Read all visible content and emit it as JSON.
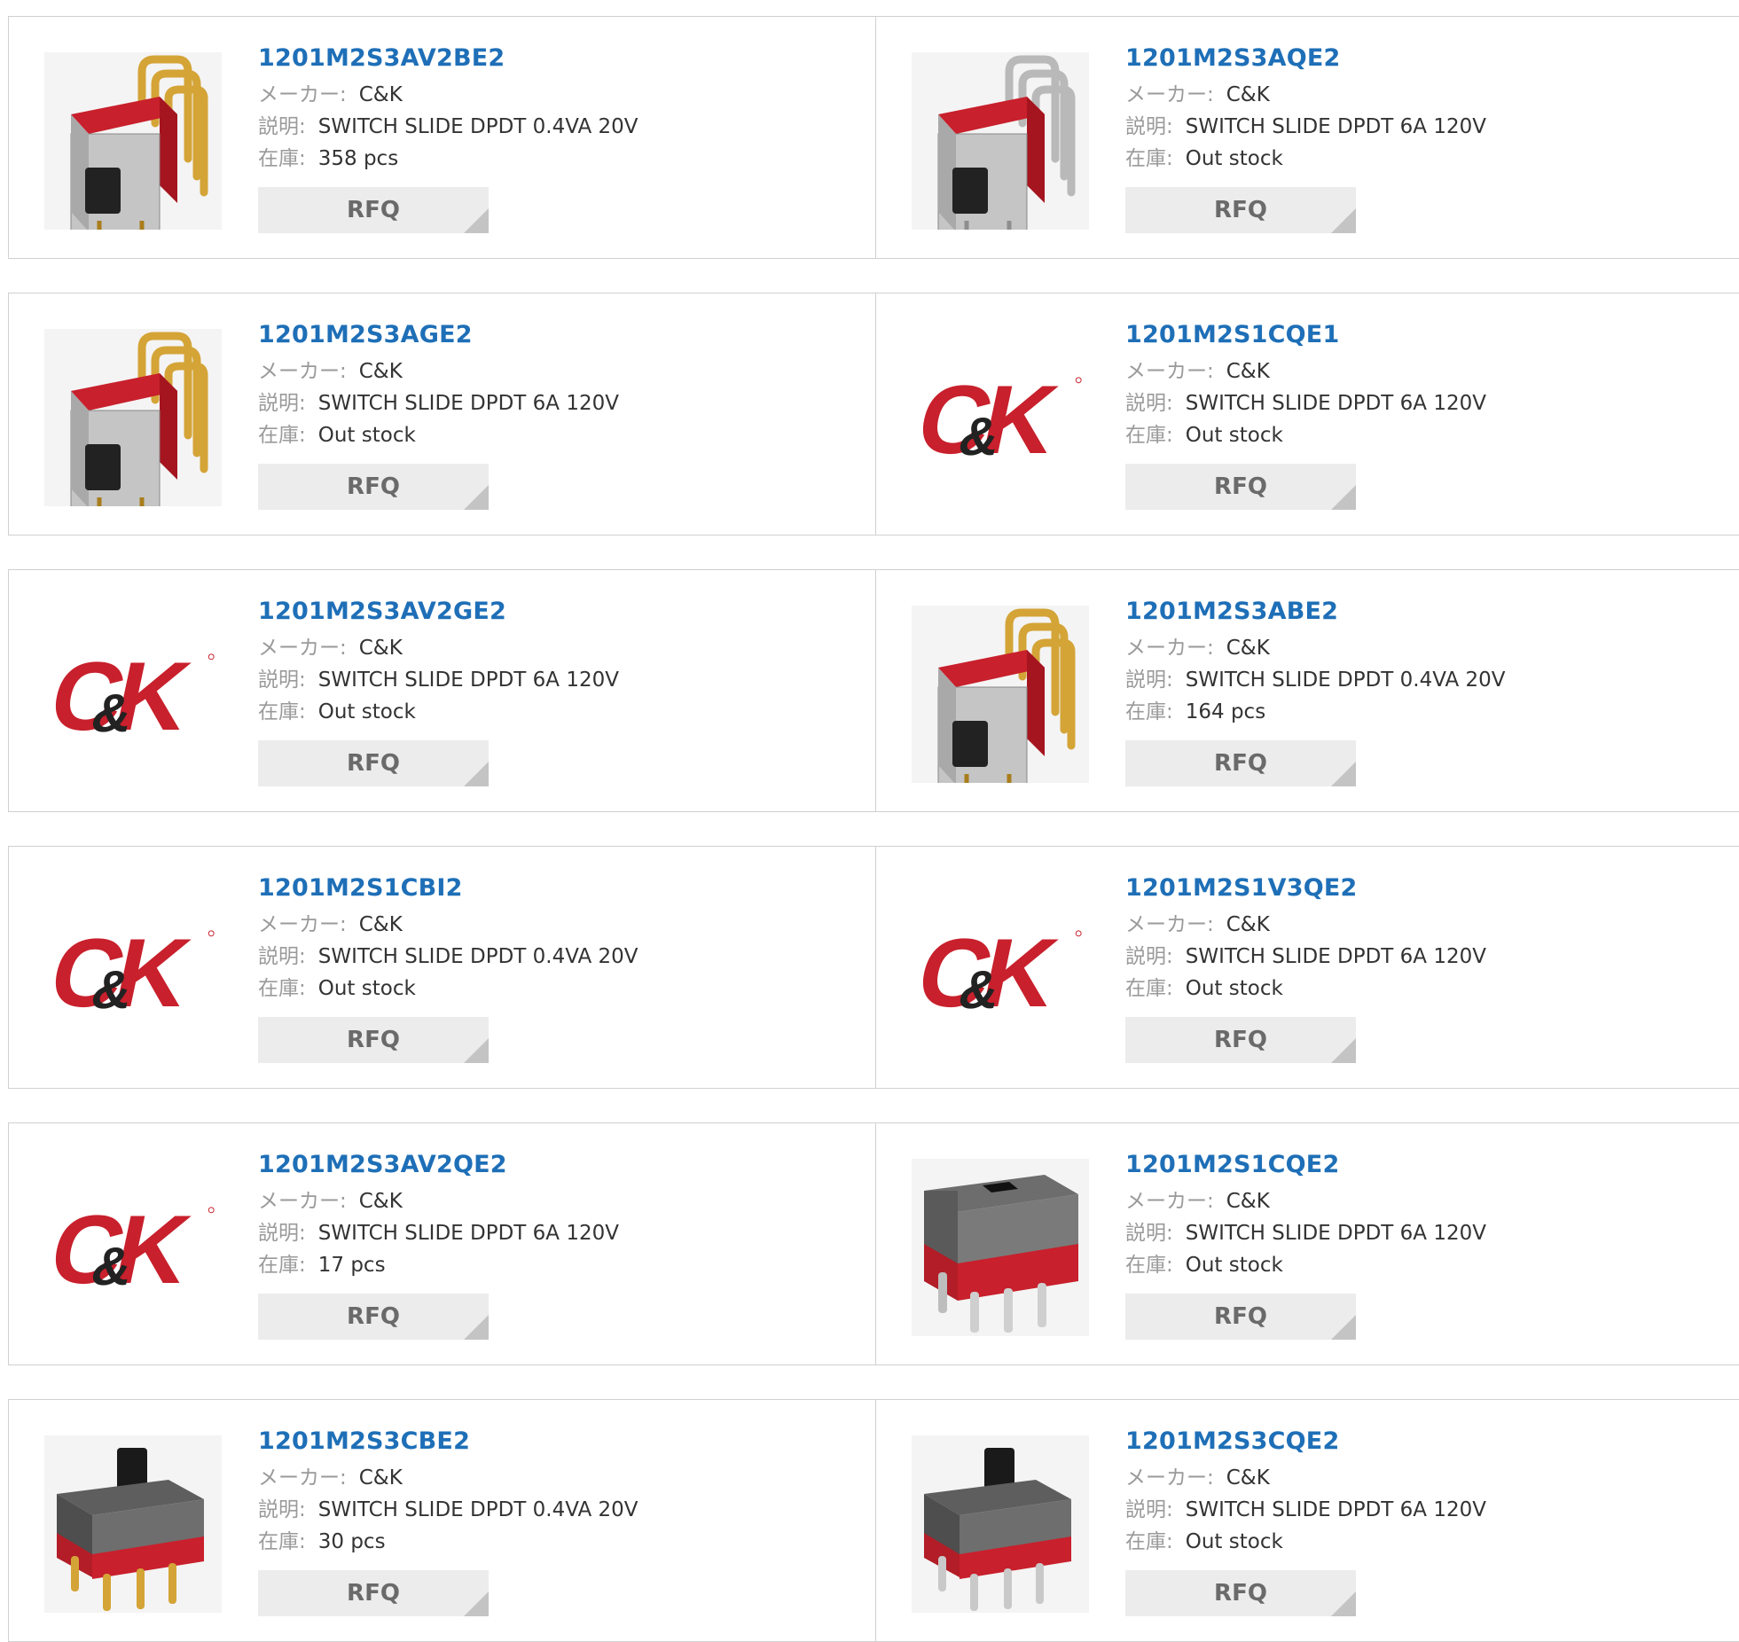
{
  "labels": {
    "maker": "メーカー:",
    "description": "説明:",
    "stock": "在庫:",
    "rfq": "RFQ"
  },
  "products": [
    {
      "pn": "1201M2S3AV2BE2",
      "maker": "C&K",
      "description": "SWITCH SLIDE DPDT 0.4VA 20V",
      "stock": "358 pcs",
      "image": "switch-right-angle-gold"
    },
    {
      "pn": "1201M2S3AQE2",
      "maker": "C&K",
      "description": "SWITCH SLIDE DPDT 6A 120V",
      "stock": "Out stock",
      "image": "switch-right-angle-silver"
    },
    {
      "pn": "1201M2S3AGE2",
      "maker": "C&K",
      "description": "SWITCH SLIDE DPDT 6A 120V",
      "stock": "Out stock",
      "image": "switch-right-angle-gold"
    },
    {
      "pn": "1201M2S1CQE1",
      "maker": "C&K",
      "description": "SWITCH SLIDE DPDT 6A 120V",
      "stock": "Out stock",
      "image": "ck-logo"
    },
    {
      "pn": "1201M2S3AV2GE2",
      "maker": "C&K",
      "description": "SWITCH SLIDE DPDT 6A 120V",
      "stock": "Out stock",
      "image": "ck-logo"
    },
    {
      "pn": "1201M2S3ABE2",
      "maker": "C&K",
      "description": "SWITCH SLIDE DPDT 0.4VA 20V",
      "stock": "164 pcs",
      "image": "switch-right-angle-gold"
    },
    {
      "pn": "1201M2S1CBI2",
      "maker": "C&K",
      "description": "SWITCH SLIDE DPDT 0.4VA 20V",
      "stock": "Out stock",
      "image": "ck-logo"
    },
    {
      "pn": "1201M2S1V3QE2",
      "maker": "C&K",
      "description": "SWITCH SLIDE DPDT 6A 120V",
      "stock": "Out stock",
      "image": "ck-logo"
    },
    {
      "pn": "1201M2S3AV2QE2",
      "maker": "C&K",
      "description": "SWITCH SLIDE DPDT 6A 120V",
      "stock": "17 pcs",
      "image": "ck-logo"
    },
    {
      "pn": "1201M2S1CQE2",
      "maker": "C&K",
      "description": "SWITCH SLIDE DPDT 6A 120V",
      "stock": "Out stock",
      "image": "switch-vertical-flat"
    },
    {
      "pn": "1201M2S3CBE2",
      "maker": "C&K",
      "description": "SWITCH SLIDE DPDT 0.4VA 20V",
      "stock": "30 pcs",
      "image": "switch-vertical-tall-gold"
    },
    {
      "pn": "1201M2S3CQE2",
      "maker": "C&K",
      "description": "SWITCH SLIDE DPDT 6A 120V",
      "stock": "Out stock",
      "image": "switch-vertical-tall-silver"
    }
  ],
  "colors": {
    "link": "#1e6fb7",
    "brand_red": "#c8202c",
    "rfq_bg": "#ececec"
  }
}
